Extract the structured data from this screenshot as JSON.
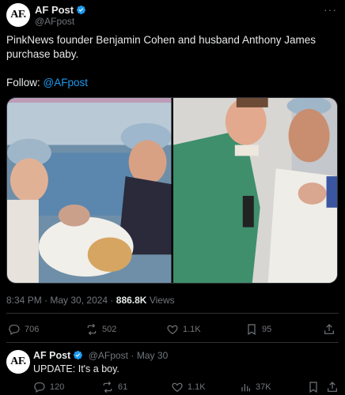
{
  "tweet": {
    "avatar_text": "AF.",
    "name": "AF Post",
    "handle": "@AFpost",
    "more": "···",
    "text": "PinkNews founder Benjamin Cohen and husband Anthony James purchase baby.",
    "follow_label": "Follow:",
    "follow_link": "@AFpost",
    "time": "8:34 PM",
    "date": "May 30, 2024",
    "views_count": "886.8K",
    "views_label": "Views",
    "replies": "706",
    "retweets": "502",
    "likes": "1.1K",
    "bookmarks": "95"
  },
  "reply": {
    "avatar_text": "AF.",
    "name": "AF Post",
    "handle": "@AFpost",
    "date": "May 30",
    "text": "UPDATE: It's a boy.",
    "replies": "120",
    "retweets": "61",
    "likes": "1.1K",
    "views": "37K"
  },
  "colors": {
    "background": "#000000",
    "text": "#e7e9ea",
    "muted": "#71767b",
    "link": "#1d9bf0",
    "verified": "#1d9bf0"
  },
  "icons": [
    "verified-badge-icon",
    "reply-icon",
    "retweet-icon",
    "like-icon",
    "bookmark-icon",
    "share-icon",
    "views-icon"
  ]
}
